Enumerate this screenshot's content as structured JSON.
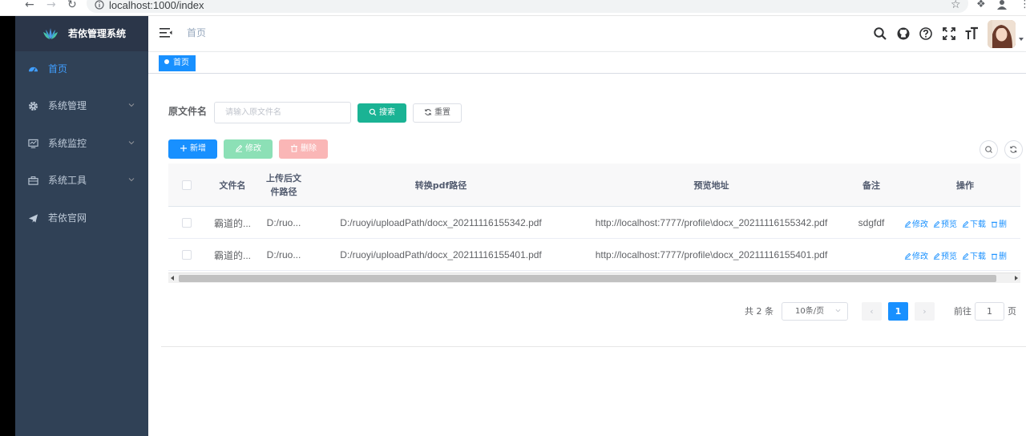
{
  "browser": {
    "url": "localhost:1000/index"
  },
  "app": {
    "title": "若依管理系统"
  },
  "sidebar": {
    "items": [
      {
        "label": "首页",
        "icon": "dashboard-icon",
        "active": true
      },
      {
        "label": "系统管理",
        "icon": "gear-icon",
        "expandable": true
      },
      {
        "label": "系统监控",
        "icon": "monitor-icon",
        "expandable": true
      },
      {
        "label": "系统工具",
        "icon": "toolbox-icon",
        "expandable": true
      },
      {
        "label": "若依官网",
        "icon": "paper-plane-icon"
      }
    ]
  },
  "header": {
    "breadcrumb": "首页"
  },
  "tags": {
    "active": "首页"
  },
  "search": {
    "label": "原文件名",
    "placeholder": "请输入原文件名",
    "value": "",
    "search_button": "搜索",
    "reset_button": "重置"
  },
  "toolbar": {
    "add": "新增",
    "edit": "修改",
    "delete": "删除"
  },
  "table": {
    "columns": {
      "name": "文件名",
      "upload_path": "上传后文件路径",
      "pdf_path": "转换pdf路径",
      "preview": "预览地址",
      "remark": "备注",
      "ops": "操作"
    },
    "rows": [
      {
        "name": "霸道的...",
        "upload_path": "D:/ruo...",
        "pdf_path": "D:/ruoyi/uploadPath/docx_20211116155342.pdf",
        "preview": "http://localhost:7777/profile\\docx_20211116155342.pdf",
        "remark": "sdgfdf"
      },
      {
        "name": "霸道的...",
        "upload_path": "D:/ruo...",
        "pdf_path": "D:/ruoyi/uploadPath/docx_20211116155401.pdf",
        "preview": "http://localhost:7777/profile\\docx_20211116155401.pdf",
        "remark": ""
      }
    ],
    "ops": {
      "edit": "修改",
      "preview": "预览",
      "download": "下载",
      "delete": "删"
    }
  },
  "pagination": {
    "total": "共 2 条",
    "page_size": "10条/页",
    "current": "1",
    "goto_label": "前往",
    "goto_value": "1",
    "unit": "页"
  },
  "colors": {
    "sidebar_bg": "#304156",
    "primary": "#1890ff",
    "search_btn": "#1ab394",
    "edit_btn_disabled": "#8ce0b6",
    "delete_btn_disabled": "#fab6b6"
  }
}
